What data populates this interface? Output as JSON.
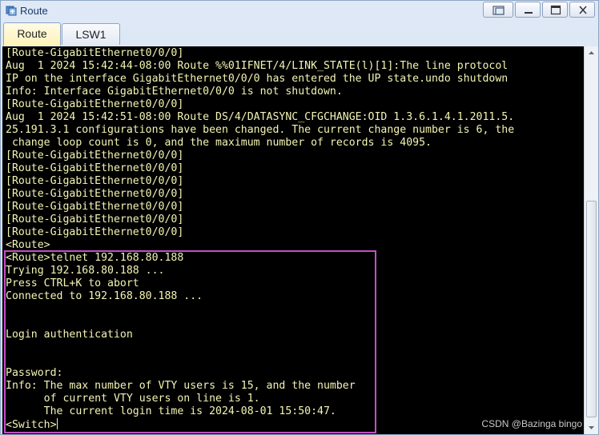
{
  "window": {
    "title": "Route",
    "icon": "route-app-icon"
  },
  "window_controls": {
    "restore_icon": "restore-icon",
    "minimize_label": "–",
    "maximize_icon": "maximize-icon",
    "close_label": "X"
  },
  "tabs": [
    {
      "label": "Route",
      "active": true
    },
    {
      "label": "LSW1",
      "active": false
    }
  ],
  "terminal": {
    "text_color": "#f4f4b4",
    "background": "#000000",
    "lines": [
      "[Route-GigabitEthernet0/0/0]",
      "Aug  1 2024 15:42:44-08:00 Route %%01IFNET/4/LINK_STATE(l)[1]:The line protocol",
      "IP on the interface GigabitEthernet0/0/0 has entered the UP state.undo shutdown",
      "Info: Interface GigabitEthernet0/0/0 is not shutdown.",
      "[Route-GigabitEthernet0/0/0]",
      "Aug  1 2024 15:42:51-08:00 Route DS/4/DATASYNC_CFGCHANGE:OID 1.3.6.1.4.1.2011.5.",
      "25.191.3.1 configurations have been changed. The current change number is 6, the",
      " change loop count is 0, and the maximum number of records is 4095.",
      "[Route-GigabitEthernet0/0/0]",
      "[Route-GigabitEthernet0/0/0]",
      "[Route-GigabitEthernet0/0/0]",
      "[Route-GigabitEthernet0/0/0]",
      "[Route-GigabitEthernet0/0/0]",
      "[Route-GigabitEthernet0/0/0]",
      "[Route-GigabitEthernet0/0/0]",
      "<Route>",
      "<Route>telnet 192.168.80.188",
      "Trying 192.168.80.188 ...",
      "Press CTRL+K to abort",
      "Connected to 192.168.80.188 ...",
      "",
      "",
      "Login authentication",
      "",
      "",
      "Password:",
      "Info: The max number of VTY users is 15, and the number",
      "      of current VTY users on line is 1.",
      "      The current login time is 2024-08-01 15:50:47.",
      "<Switch>"
    ],
    "highlight_color": "#c24fc4"
  },
  "watermark": "CSDN @Bazinga bingo"
}
